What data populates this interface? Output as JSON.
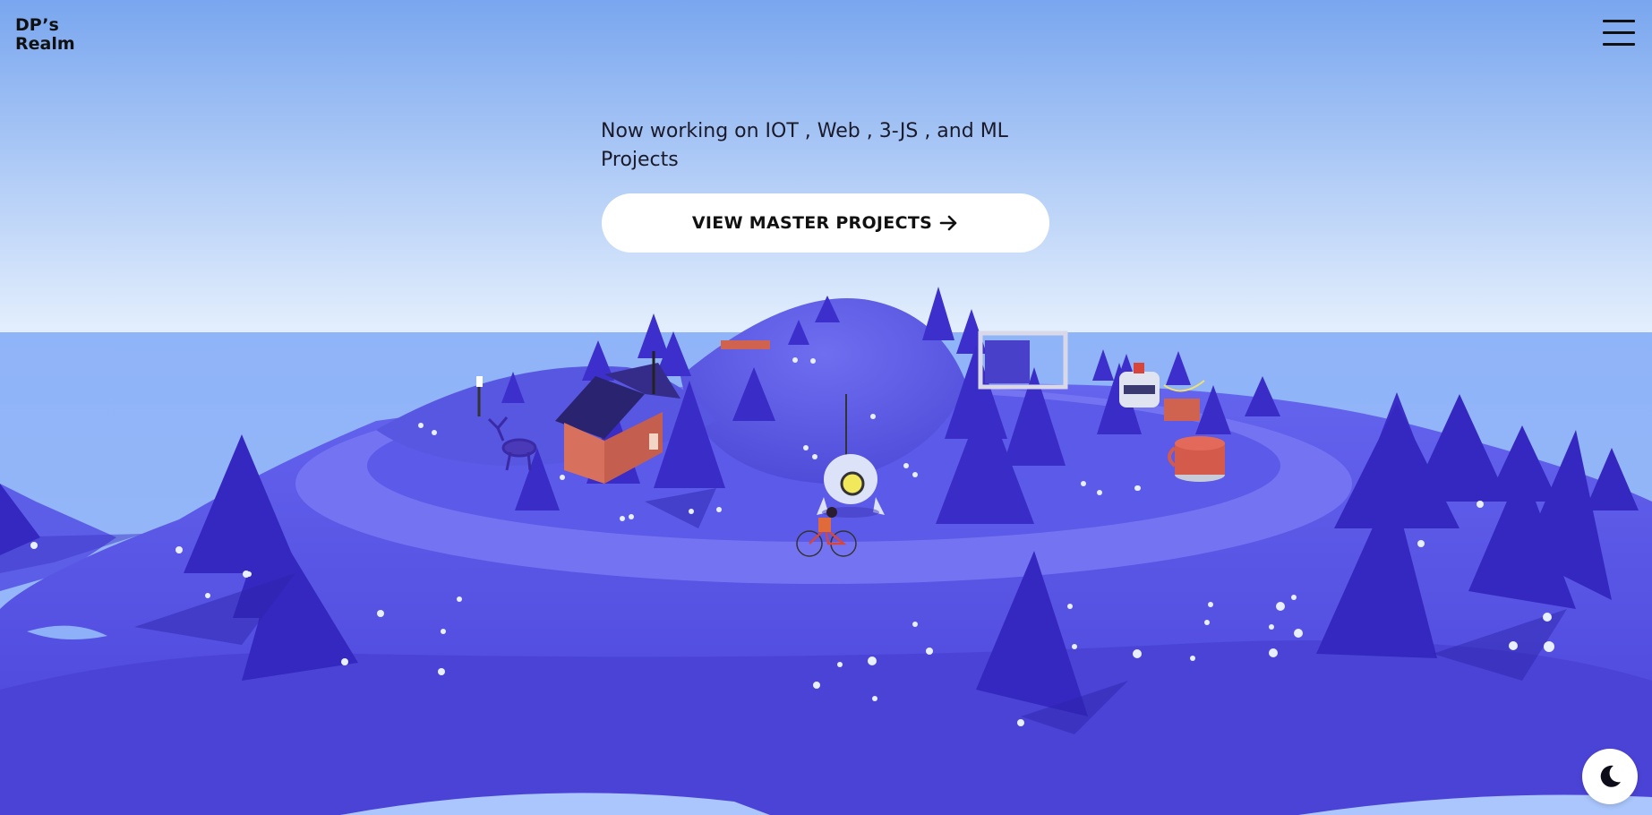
{
  "header": {
    "logo_line1": "DP’s",
    "logo_line2": "Realm",
    "menu_icon": "hamburger-menu-icon"
  },
  "hero": {
    "subtitle": "Now working on IOT , Web , 3-JS , and ML Projects",
    "cta_label": "VIEW MASTER PROJECTS",
    "cta_icon": "arrow-right-icon"
  },
  "controls": {
    "theme_toggle_icon": "moon-icon"
  },
  "colors": {
    "sky_top": "#79a6ef",
    "sky_horizon": "#e4effd",
    "sea": "#8cb3f7",
    "island": "#5a5ae6",
    "trees": "#3c2ec8",
    "cabin": "#d7705c",
    "button_bg": "#ffffff",
    "text": "#111111"
  }
}
